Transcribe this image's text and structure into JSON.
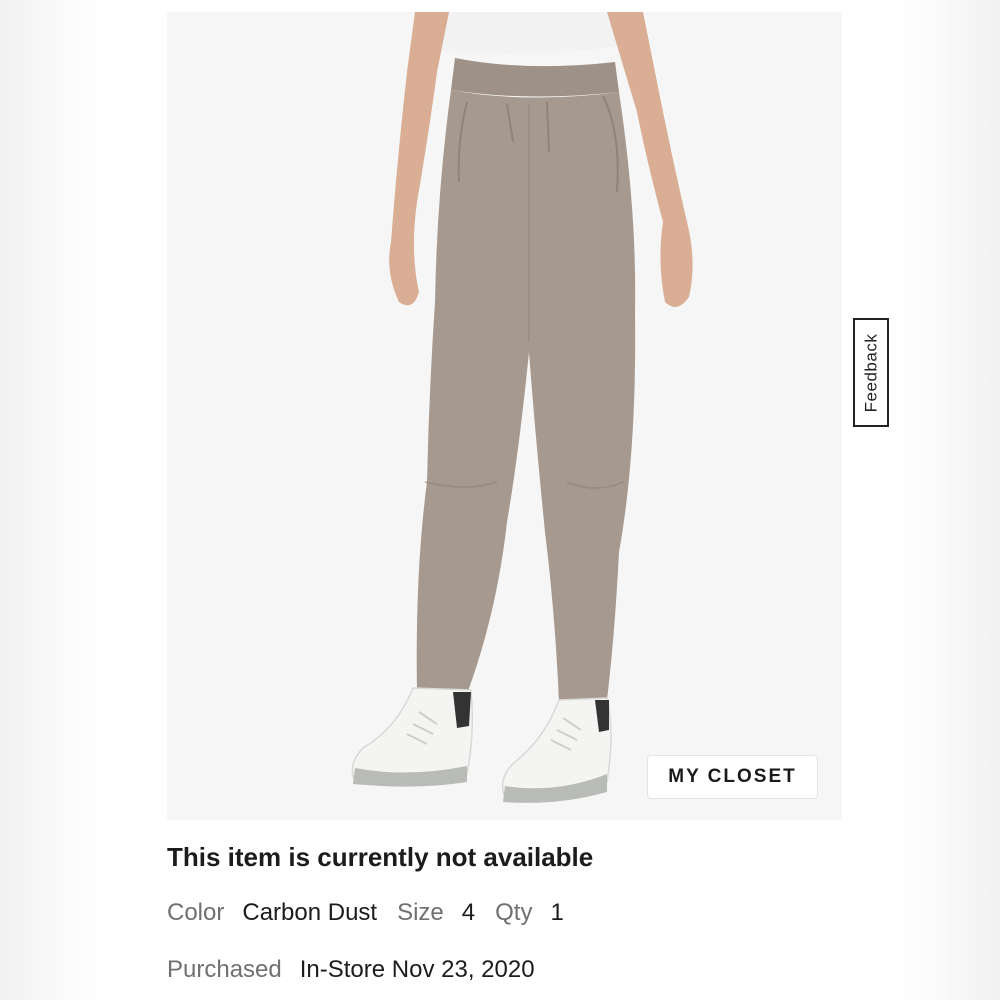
{
  "product": {
    "image_alt": "Carbon Dust high-rise pleated pants with white sneakers",
    "colors": {
      "pant": "#a69a90",
      "pant_shadow": "#8f837a",
      "waistband": "#9e9288",
      "skin": "#d9ae94",
      "top": "#f2f2f2",
      "sneaker": "#f4f4f2",
      "sneaker_accent": "#b9bcb6",
      "background": "#f6f6f6"
    }
  },
  "buttons": {
    "my_closet": "MY CLOSET",
    "feedback": "Feedback"
  },
  "item": {
    "status": "This item is currently not available",
    "color_label": "Color",
    "color_value": "Carbon Dust",
    "size_label": "Size",
    "size_value": "4",
    "qty_label": "Qty",
    "qty_value": "1",
    "purchased_label": "Purchased",
    "purchased_value": "In-Store Nov 23, 2020"
  }
}
